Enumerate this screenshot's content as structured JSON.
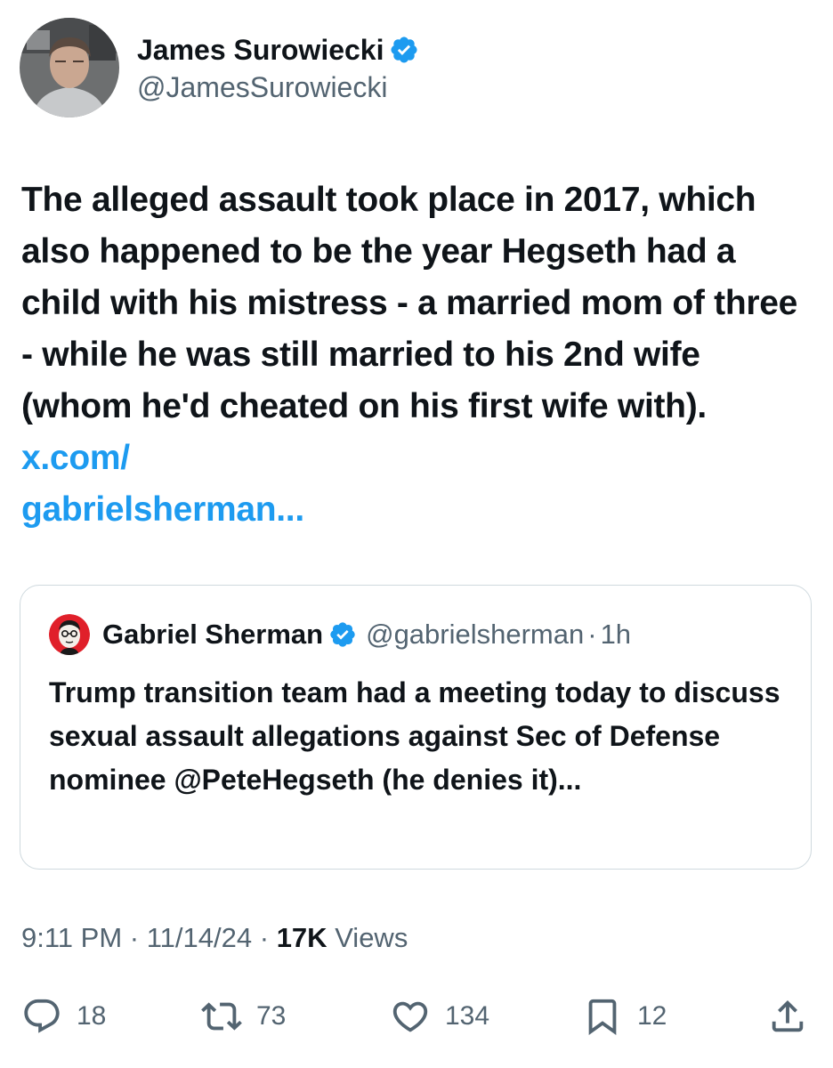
{
  "author": {
    "display_name": "James Surowiecki",
    "handle": "@JamesSurowiecki",
    "verified": true
  },
  "tweet": {
    "text": "The alleged assault took place in 2017, which also happened to be the year Hegseth had a child with his mistress - a married mom of three - while he was still married to his 2nd wife (whom he'd cheated on his first wife with).",
    "link_text": "x.com/\ngabrielsherman..."
  },
  "quote": {
    "display_name": "Gabriel Sherman",
    "handle": "@gabrielsherman",
    "separator": "·",
    "time": "1h",
    "text": "Trump transition team had a meeting today to discuss sexual assault allegations against Sec of Defense nominee @PeteHegseth (he denies it)...",
    "verified": true
  },
  "meta": {
    "time": "9:11 PM",
    "date": "11/14/24",
    "separator": "·",
    "views_count": "17K",
    "views_label": "Views"
  },
  "actions": {
    "replies": "18",
    "reposts": "73",
    "likes": "134",
    "bookmarks": "12"
  },
  "icons": {
    "reply": "reply-icon",
    "repost": "repost-icon",
    "like": "heart-icon",
    "bookmark": "bookmark-icon",
    "share": "share-icon",
    "verified": "verified-badge-icon"
  },
  "colors": {
    "link": "#1d9bf0",
    "secondary_text": "#536471",
    "primary_text": "#0f1419",
    "verified": "#1d9bf0",
    "border": "#cfd9de"
  }
}
